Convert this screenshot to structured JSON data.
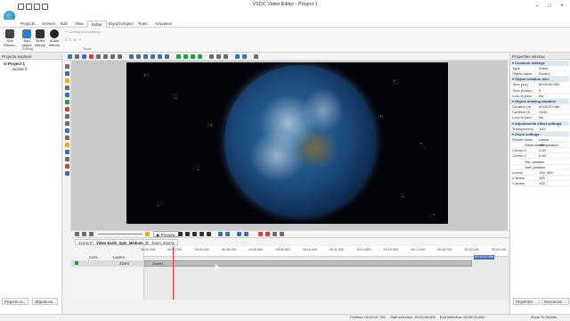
{
  "window": {
    "title": "VSDC Video Editor - Project 1"
  },
  "menu": {
    "tabs": [
      "Projects",
      "Scenes",
      "Edit",
      "View",
      "Editor",
      "Export project",
      "Tools",
      "Activation"
    ],
    "active": "Editor"
  },
  "ribbon": {
    "buttons": [
      {
        "label": "Run Wizard...",
        "icon": "wizard-icon"
      },
      {
        "label": "Add object",
        "icon": "add-object-icon"
      },
      {
        "label": "Video effects",
        "icon": "video-effects-icon"
      },
      {
        "label": "Audio effects",
        "icon": "audio-effects-icon"
      }
    ],
    "cutting_label": "Cutting and splitting",
    "groups": [
      "Editing",
      "Tools"
    ]
  },
  "explorer": {
    "title": "Projects explorer",
    "tree": [
      {
        "label": "Project 1"
      },
      {
        "label": "Scene 0"
      }
    ],
    "tabs": [
      "Projects ex...",
      "Objects ex..."
    ]
  },
  "timeline": {
    "preview_label": "Preview",
    "tabs": [
      "Scene 0",
      "Video Earth_Spin_Medium_S...",
      "Zoom: Zoom1"
    ],
    "header": {
      "com": "Com...",
      "layers": "Layers",
      "track_label": "Zoom"
    },
    "clip_label": "Zoom1",
    "ticks": [
      "00:00.000",
      "00:01.700",
      "00:03.400",
      "00:05.100",
      "00:06.800",
      "00:08.500",
      "00:10.200",
      "00:11.900",
      "00:13.600",
      "00:15.300",
      "00:17.000",
      "00:18.700",
      "00:20.400",
      "00:22.100"
    ],
    "end_time": "00:00:20.066"
  },
  "properties": {
    "title": "Properties window",
    "sections": [
      {
        "title": "Common settings",
        "rows": [
          [
            "Type",
            "Zoom"
          ],
          [
            "Object name",
            "Zoom1"
          ]
        ]
      },
      {
        "title": "Object creation time",
        "rows": [
          [
            "Time (ms)",
            "00:00:00.000"
          ],
          [
            "Time (frame)",
            "0"
          ],
          [
            "Lock to pare",
            "No"
          ]
        ]
      },
      {
        "title": "Object drawing duration",
        "rows": [
          [
            "Duration (m",
            "00:00:20.066"
          ],
          [
            "Duration (fr",
            "1204"
          ],
          [
            "Lock to pare",
            "No"
          ]
        ]
      },
      {
        "title": "Adjustments effect settings",
        "rows": [
          [
            "Transparency",
            "100"
          ]
        ]
      },
      {
        "title": "Zoom settings",
        "rows": [
          [
            "Resize mode",
            "Linear interpolation"
          ],
          [
            "",
            "Show center"
          ],
          [
            "Center X",
            "0.50"
          ],
          [
            "Center Y",
            "0.50"
          ],
          [
            "",
            "Hor. position"
          ],
          [
            "",
            "Vert. position"
          ],
          [
            "Levels",
            "100; 300"
          ],
          [
            "X levels",
            "100"
          ],
          [
            "Y levels",
            "100"
          ]
        ]
      }
    ],
    "bottom_tabs": [
      "Properties ...",
      "Resources ..."
    ]
  },
  "status": {
    "position": "Position: 00:00:01.750",
    "start_selection": "Start selection: 00:00:00.000",
    "end_selection": "End selection: 00:00:00.000",
    "zoom": "Zoom To Screen"
  },
  "colors": {
    "accent": "#1e6fb6",
    "playhead": "#d23a3a",
    "section_header": "#dfe7f1"
  }
}
